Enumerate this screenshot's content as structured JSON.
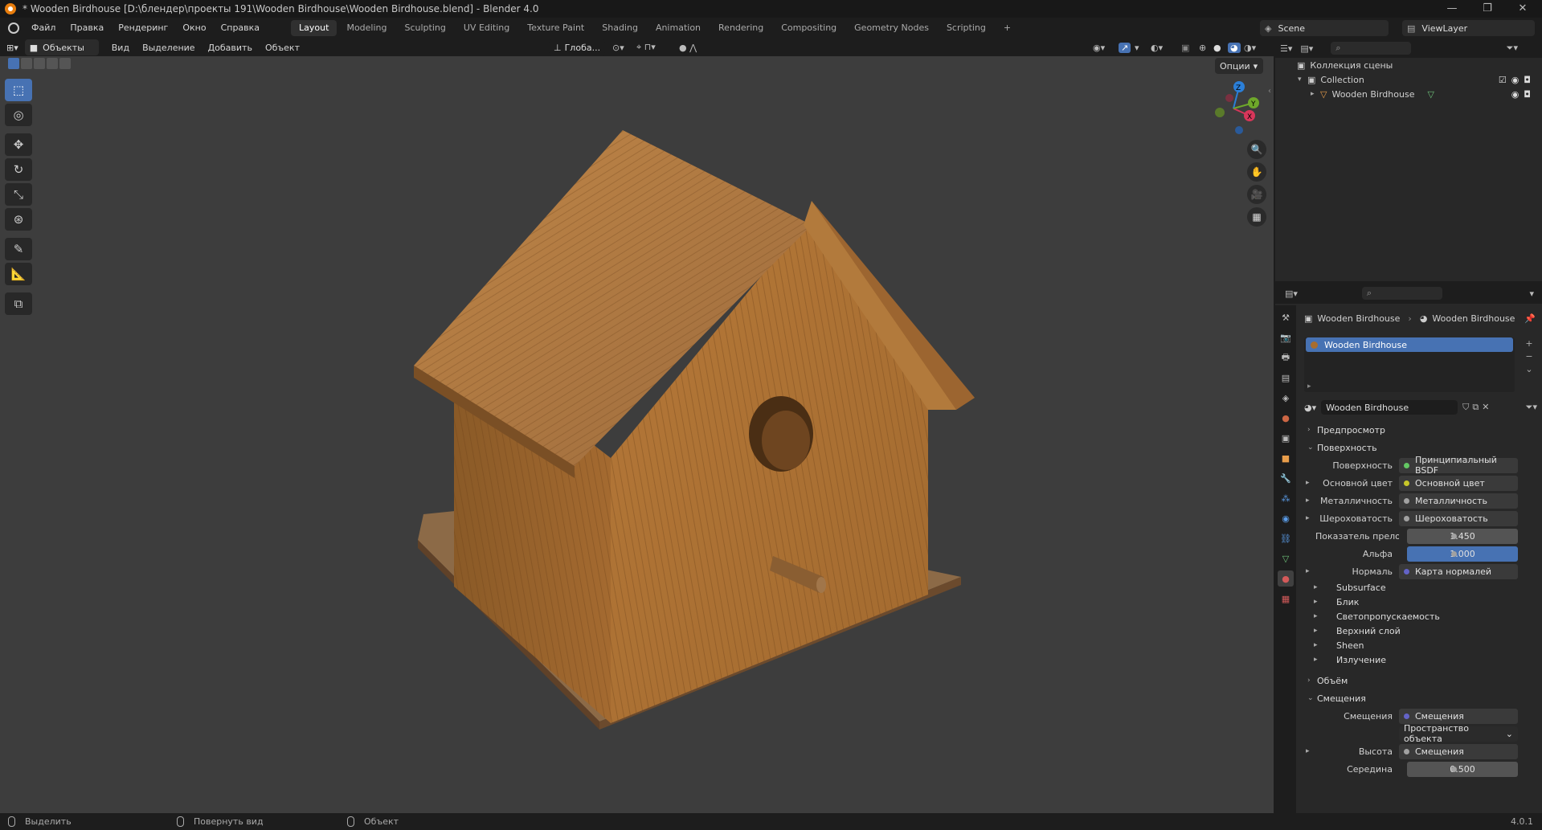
{
  "window": {
    "title": "* Wooden Birdhouse [D:\\блендер\\проекты 191\\Wooden Birdhouse\\Wooden Birdhouse.blend] - Blender 4.0",
    "minimize": "—",
    "maximize": "❐",
    "close": "✕"
  },
  "menubar": {
    "items": [
      "Файл",
      "Правка",
      "Рендеринг",
      "Окно",
      "Справка"
    ]
  },
  "workspaces": {
    "tabs": [
      "Layout",
      "Modeling",
      "Sculpting",
      "UV Editing",
      "Texture Paint",
      "Shading",
      "Animation",
      "Rendering",
      "Compositing",
      "Geometry Nodes",
      "Scripting"
    ],
    "active": "Layout",
    "add": "+"
  },
  "scene": {
    "name": "Scene",
    "view_layer": "ViewLayer"
  },
  "viewport_header": {
    "mode": "Объекты",
    "menus": [
      "Вид",
      "Выделение",
      "Добавить",
      "Объект"
    ],
    "orientation": "Глоба...",
    "options": "Опции"
  },
  "gizmo": {
    "z": "Z",
    "x": "X",
    "y": "Y"
  },
  "toolbar": {
    "tools": [
      "select-box-icon",
      "cursor-icon",
      "move-icon",
      "rotate-icon",
      "scale-icon",
      "transform-icon",
      "annotate-icon",
      "measure-icon",
      "add-cube-icon"
    ]
  },
  "outliner": {
    "root": "Коллекция сцены",
    "collection": "Collection",
    "object": "Wooden Birdhouse"
  },
  "properties": {
    "breadcrumb": [
      "Wooden Birdhouse",
      "Wooden Birdhouse"
    ],
    "slot": "Wooden Birdhouse",
    "material_name": "Wooden Birdhouse",
    "sections": {
      "preview": "Предпросмотр",
      "surface": "Поверхность",
      "volume": "Объём",
      "displacement": "Смещения"
    },
    "surface_rows": [
      {
        "label": "Поверхность",
        "value": "Принципиальный BSDF",
        "socket": "green",
        "expand": false
      },
      {
        "label": "Основной цвет",
        "value": "Основной цвет",
        "socket": "yellow",
        "expand": true
      },
      {
        "label": "Металличность",
        "value": "Металличность",
        "socket": "grey",
        "expand": true
      },
      {
        "label": "Шероховатость",
        "value": "Шероховатость",
        "socket": "grey",
        "expand": true
      },
      {
        "label": "Показатель прело...",
        "value": "1.450",
        "socket": "grey",
        "expand": false,
        "numeric": true
      },
      {
        "label": "Альфа",
        "value": "1.000",
        "socket": "grey",
        "expand": false,
        "numeric": true,
        "highlight": true
      },
      {
        "label": "Нормаль",
        "value": "Карта нормалей",
        "socket": "purple",
        "expand": true
      }
    ],
    "subpanels": [
      "Subsurface",
      "Блик",
      "Светопропускаемость",
      "Верхний слой",
      "Sheen",
      "Излучение"
    ],
    "displacement_rows": [
      {
        "label": "Смещения",
        "value": "Смещения",
        "socket": "purple"
      },
      {
        "label": "",
        "value": "Пространство объекта",
        "dropdown": true
      },
      {
        "label": "Высота",
        "value": "Смещения",
        "socket": "grey",
        "expand": true
      },
      {
        "label": "Середина",
        "value": "0.500",
        "socket": "grey",
        "numeric": true
      }
    ]
  },
  "statusbar": {
    "select": "Выделить",
    "rotate": "Повернуть вид",
    "object": "Объект",
    "version": "4.0.1"
  },
  "colors": {
    "accent": "#4772b3",
    "wood": "#a86d2e",
    "viewport_bg": "#3d3d3d"
  }
}
